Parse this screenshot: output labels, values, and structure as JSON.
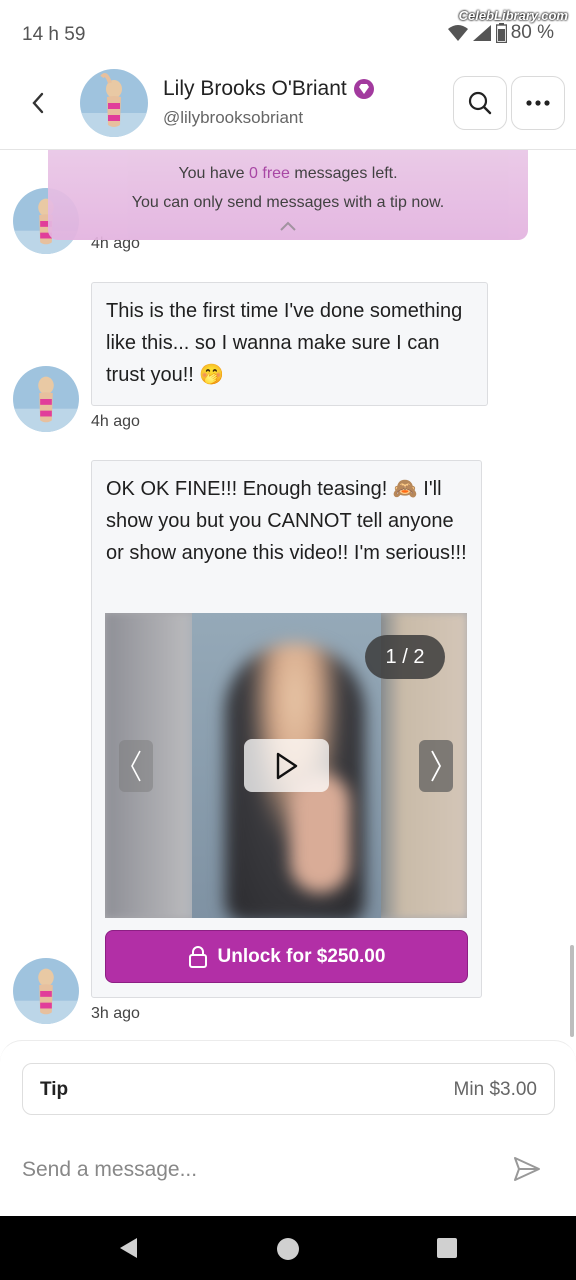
{
  "status_bar": {
    "time": "14 h 59",
    "battery": "80 %",
    "watermark": "CelebLibrary.com"
  },
  "header": {
    "name": "Lily Brooks O'Briant",
    "handle": "@lilybrooksobriant",
    "verified_badge_color": "#a23a9e"
  },
  "banner": {
    "line1_prefix": "You have ",
    "line1_count": "0",
    "line1_free": " free",
    "line1_suffix": " messages left.",
    "line2": "You can only send messages with a tip now.",
    "accent_color": "#a23a9e"
  },
  "messages": [
    {
      "time": "4h ago"
    },
    {
      "text": "This is the first time I've done something like this... so I wanna make sure I can trust you!! 🤭",
      "time": "4h ago"
    },
    {
      "text": "OK OK FINE!!! Enough teasing! 🙈 I'll show you but you CANNOT tell anyone or show anyone this video!! I'm serious!!!",
      "media_counter": "1 / 2",
      "unlock_label": "Unlock for $250.00",
      "time": "3h ago"
    }
  ],
  "composer": {
    "tip_label": "Tip",
    "tip_min": "Min $3.00",
    "message_placeholder": "Send a message..."
  },
  "colors": {
    "accent": "#b22fa6",
    "banner_bg": "#e6bde2"
  }
}
